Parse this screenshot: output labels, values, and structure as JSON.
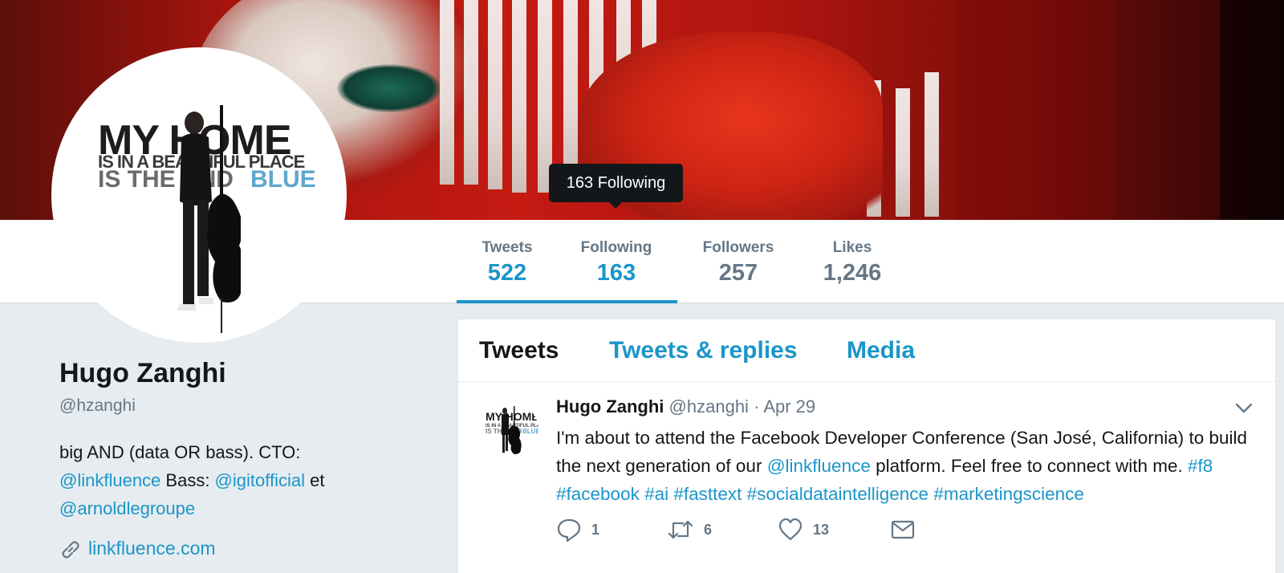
{
  "profile": {
    "name": "Hugo Zanghi",
    "handle": "@hzanghi",
    "bio_text_1": "big AND (data OR bass). CTO:",
    "bio_link_1": "@linkfluence",
    "bio_text_2": " Bass: ",
    "bio_link_2": "@igitofficial",
    "bio_text_3": " et",
    "bio_link_3": "@arnoldlegroupe",
    "website": "linkfluence.com",
    "avatar_lines": [
      "MY HOME",
      "IS IN A BEAUTIFUL PLACE",
      "IS THE AND",
      "BLUE"
    ]
  },
  "nav": {
    "items": [
      {
        "label": "Tweets",
        "value": "522"
      },
      {
        "label": "Following",
        "value": "163"
      },
      {
        "label": "Followers",
        "value": "257"
      },
      {
        "label": "Likes",
        "value": "1,246"
      }
    ],
    "tooltip": "163 Following"
  },
  "tabs": [
    "Tweets",
    "Tweets & replies",
    "Media"
  ],
  "tweet": {
    "name": "Hugo Zanghi",
    "handle": "@hzanghi",
    "separator": "·",
    "date": "Apr 29",
    "text_1": "I'm about to attend the Facebook Developer Conference (San José, California) to build the next generation of our ",
    "mention": "@linkfluence",
    "text_2": " platform. Feel free to connect with me. ",
    "hashtags": "#f8 #facebook #ai #fasttext #socialdataintelligence #marketingscience",
    "replies": "1",
    "retweets": "6",
    "likes": "13"
  },
  "colors": {
    "accent": "#1b95c9",
    "muted": "#657786",
    "text": "#14171a",
    "background": "#e6ecf0"
  },
  "icons": [
    "reply-icon",
    "retweet-icon",
    "like-icon",
    "message-icon",
    "link-icon",
    "chevron-down-icon"
  ]
}
